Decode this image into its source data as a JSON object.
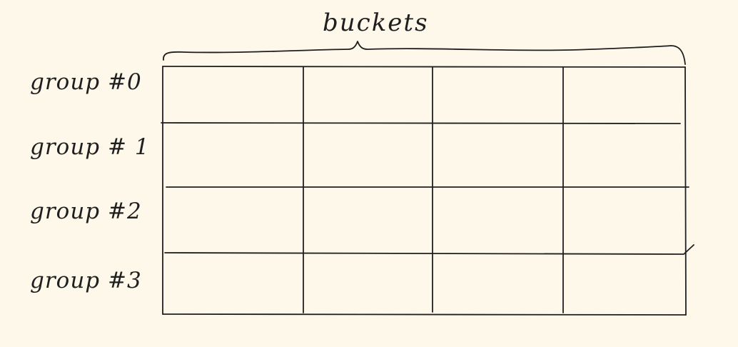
{
  "title": "buckets",
  "rows": [
    "group #0",
    "group # 1",
    "group #2",
    "group #3"
  ],
  "bucket_count": 4,
  "colors": {
    "background": "#fdf8e9",
    "ink": "#1f1f1f"
  }
}
